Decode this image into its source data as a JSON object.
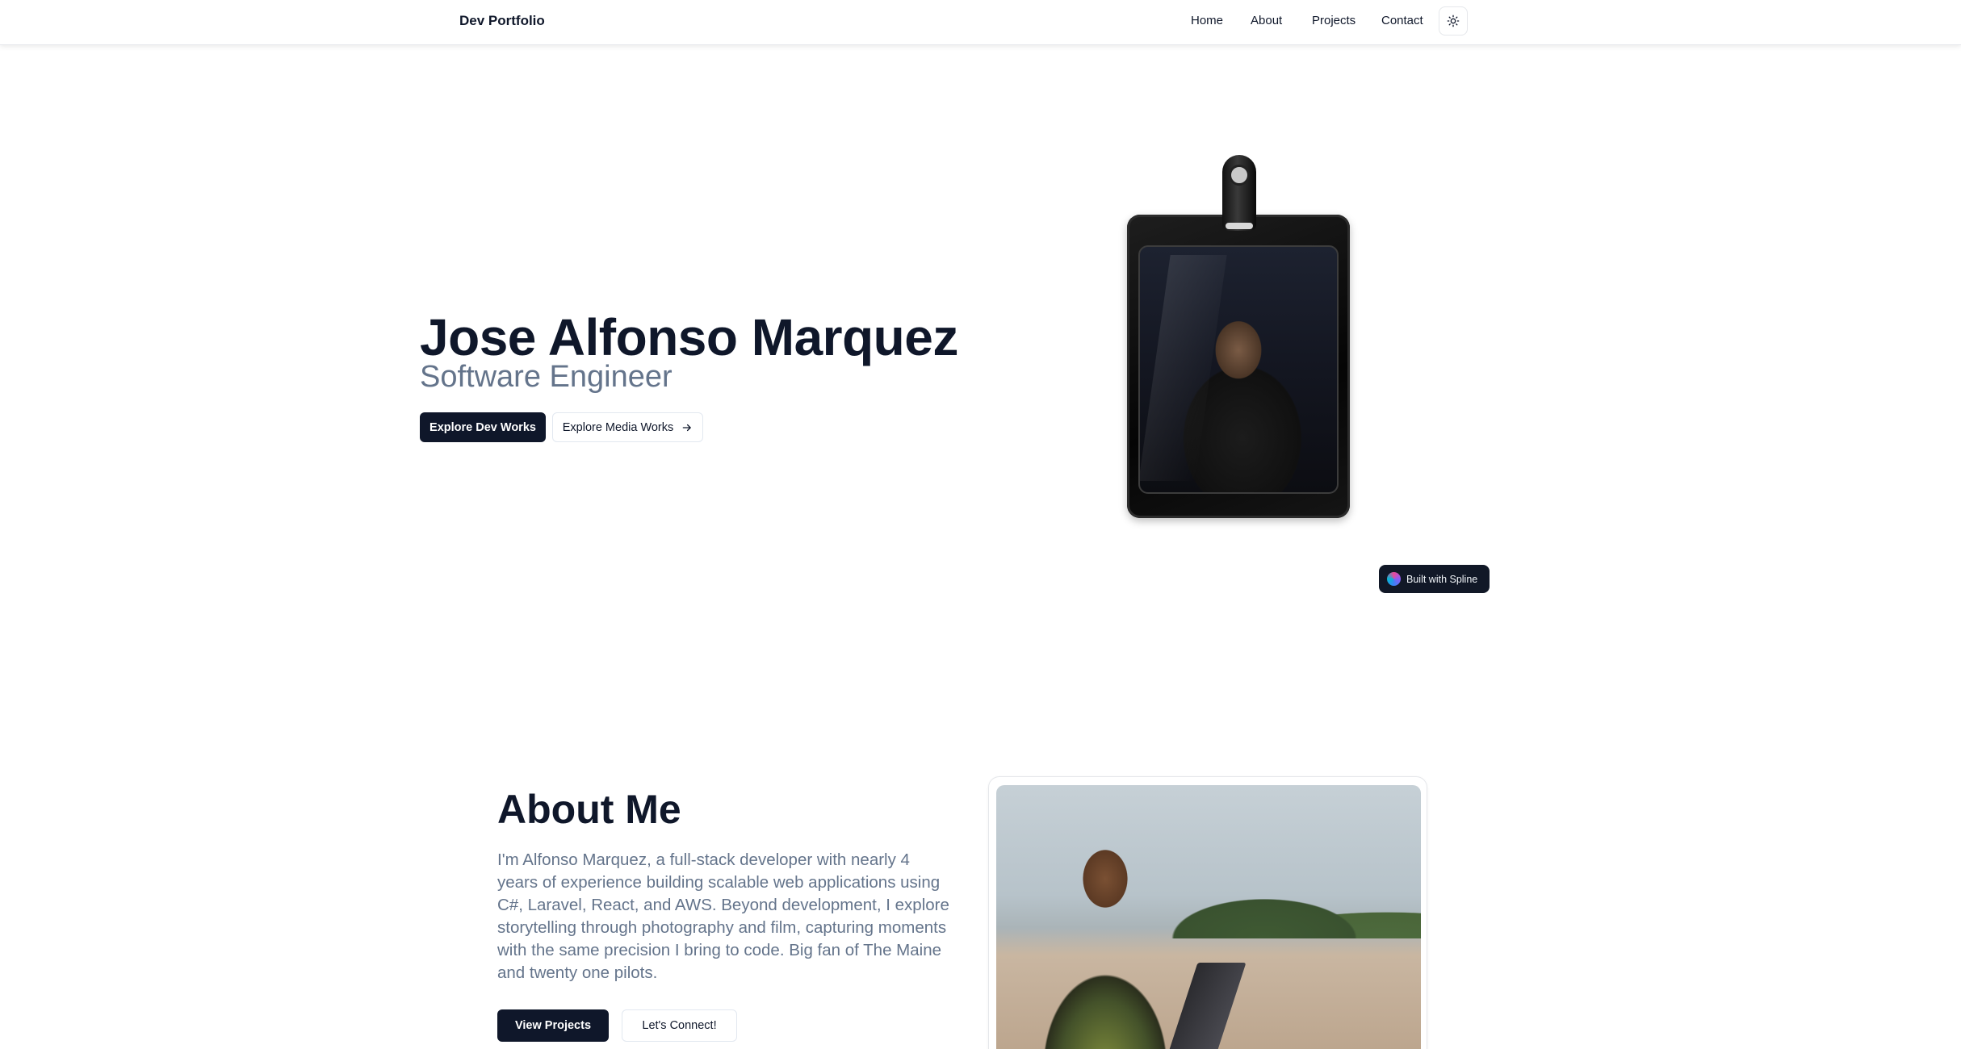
{
  "navbar": {
    "brand": "Dev Portfolio",
    "links": [
      "Home",
      "About",
      "Projects",
      "Contact"
    ],
    "theme_toggle_icon": "sun-icon"
  },
  "hero": {
    "name": "Jose Alfonso Marquez",
    "role": "Software Engineer",
    "primary_button": "Explore Dev Works",
    "secondary_button": "Explore Media Works",
    "secondary_button_icon": "arrow-right-icon",
    "badge_image": "id-badge-with-photo",
    "spline_badge": "Built with Spline"
  },
  "about": {
    "title": "About Me",
    "text": "I'm Alfonso Marquez, a full-stack developer with nearly 4 years of experience building scalable web applications using C#, Laravel, React, and AWS. Beyond development, I explore storytelling through photography and film, capturing moments with the same precision I bring to code. Big fan of The Maine and twenty one pilots.",
    "primary_button": "View Projects",
    "secondary_button": "Let's Connect!",
    "photo": "portrait-on-beach-with-laptop"
  },
  "colors": {
    "primary": "#0f172a",
    "muted_text": "#64748b",
    "border": "#e2e8f0"
  }
}
